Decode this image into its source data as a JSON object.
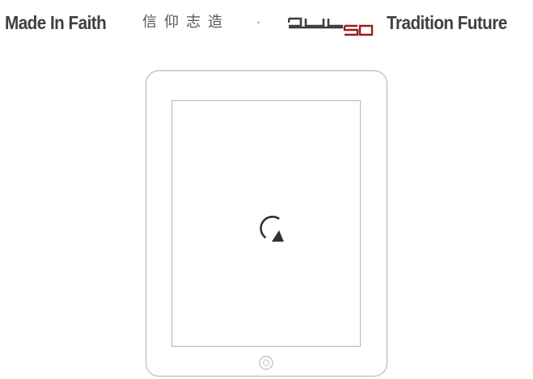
{
  "banner": {
    "left_text": "Made In Faith",
    "cjk_text": "信仰志造",
    "separator": "·",
    "logo_main": "911",
    "logo_sub": "50",
    "right_text": "Tradition Future"
  },
  "colors": {
    "banner_text": "#3f3f3f",
    "logo_accent": "#9c1b1b",
    "device_stroke": "#bdbdbd",
    "icon": "#333333"
  },
  "device": {
    "screen_icon": "rotate-icon",
    "home_button_icon": "home-button-icon"
  }
}
